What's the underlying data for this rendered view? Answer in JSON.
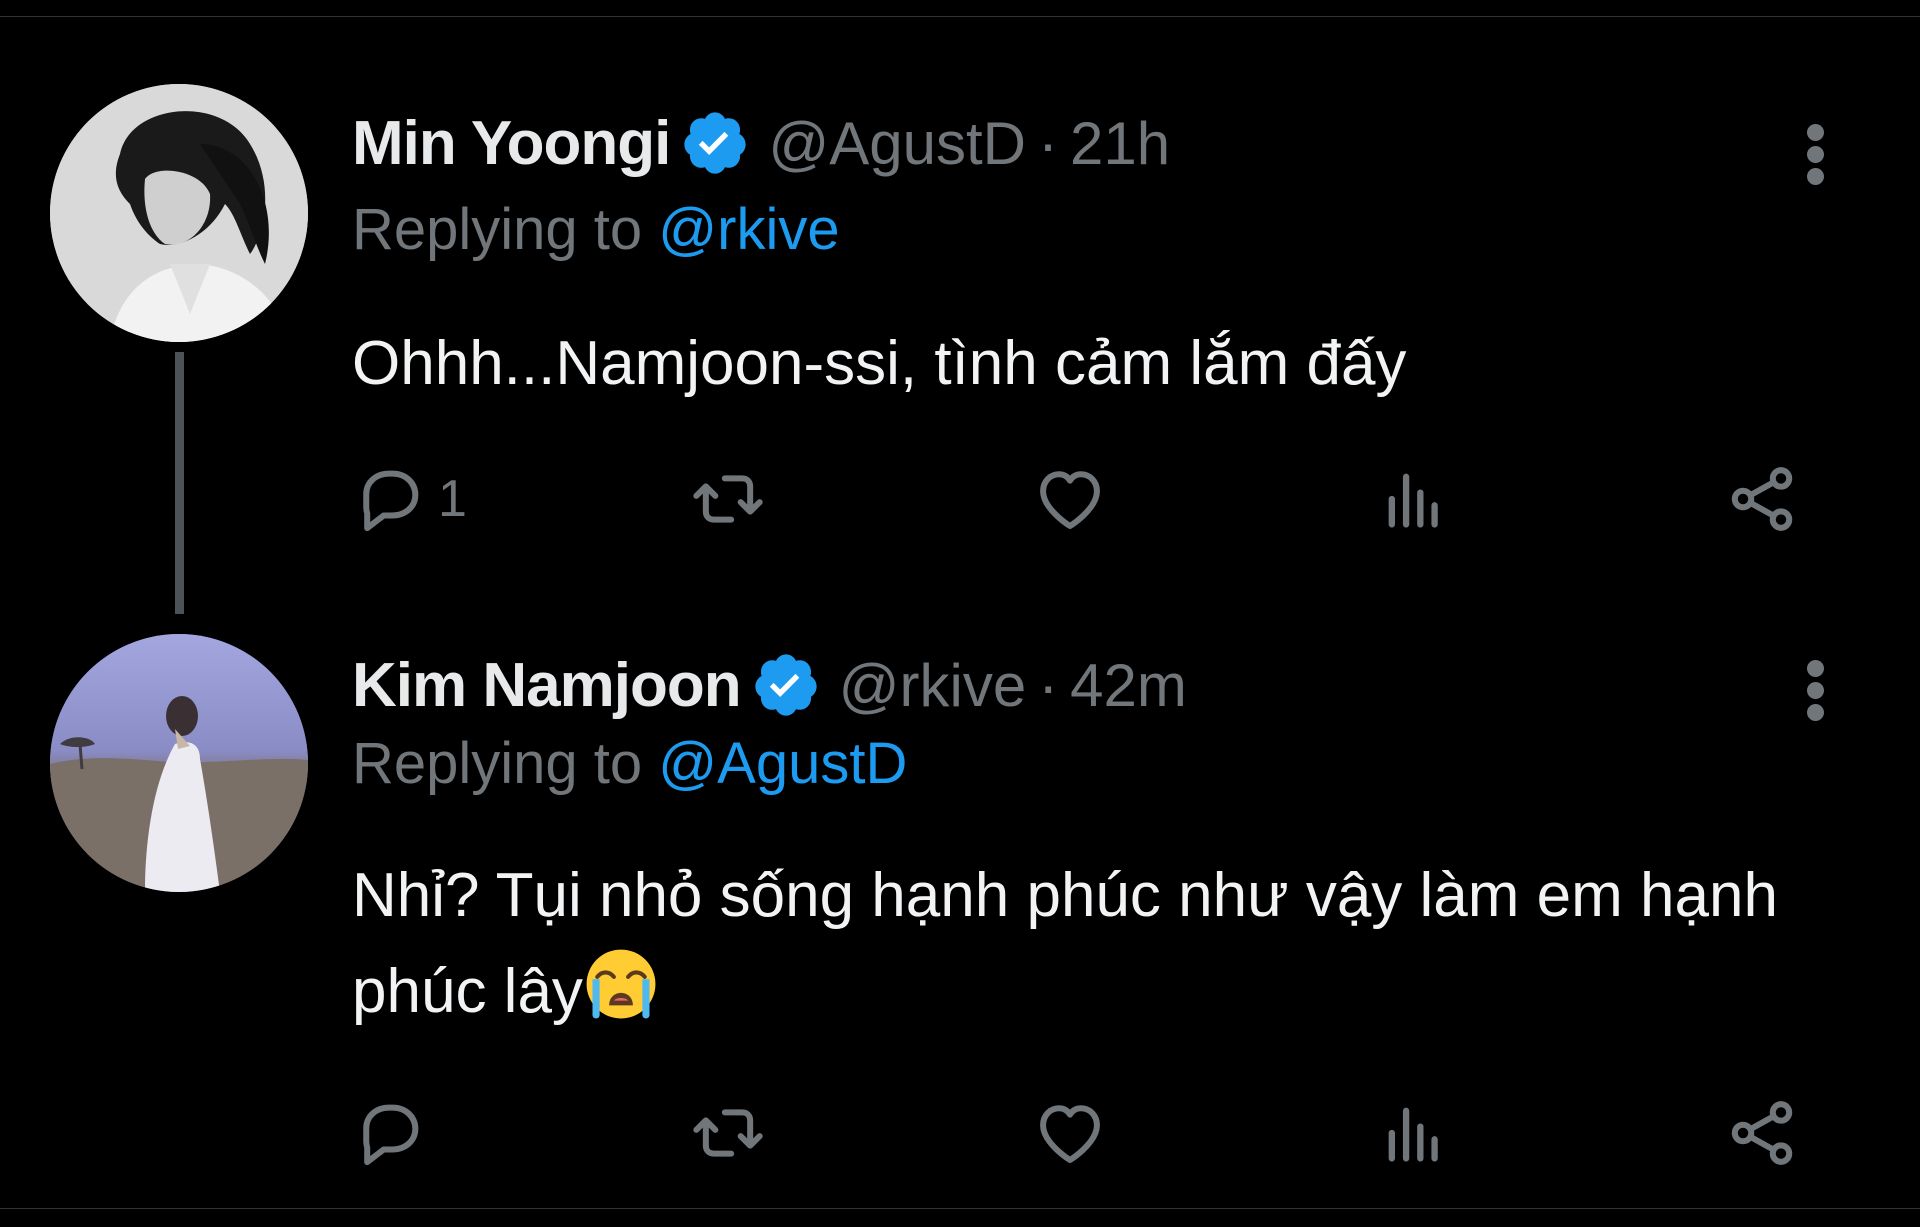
{
  "tweets": [
    {
      "display_name": "Min Yoongi",
      "handle": "@AgustD",
      "separator": "·",
      "time": "21h",
      "replying_prefix": "Replying to",
      "replying_to": "@rkive",
      "text": "Ohhh...Namjoon-ssi, tình cảm lắm đấy",
      "reply_count": "1",
      "verified": true,
      "icons": [
        "reply-icon",
        "retweet-icon",
        "like-icon",
        "views-icon",
        "share-icon",
        "more-icon",
        "verified-icon"
      ]
    },
    {
      "display_name": "Kim Namjoon",
      "handle": "@rkive",
      "separator": "·",
      "time": "42m",
      "replying_prefix": "Replying to",
      "replying_to": "@AgustD",
      "text": "Nhỉ? Tụi nhỏ sống hạnh phúc như vậy làm em hạnh phúc lây",
      "reply_count": "",
      "verified": true,
      "emoji": "loudly-crying-face",
      "icons": [
        "reply-icon",
        "retweet-icon",
        "like-icon",
        "views-icon",
        "share-icon",
        "more-icon",
        "verified-icon"
      ]
    }
  ],
  "colors": {
    "background": "#000000",
    "primary_text": "#e7e9ea",
    "secondary_text": "#71767b",
    "accent": "#1d9bf0",
    "thread_line": "#4d5257"
  }
}
